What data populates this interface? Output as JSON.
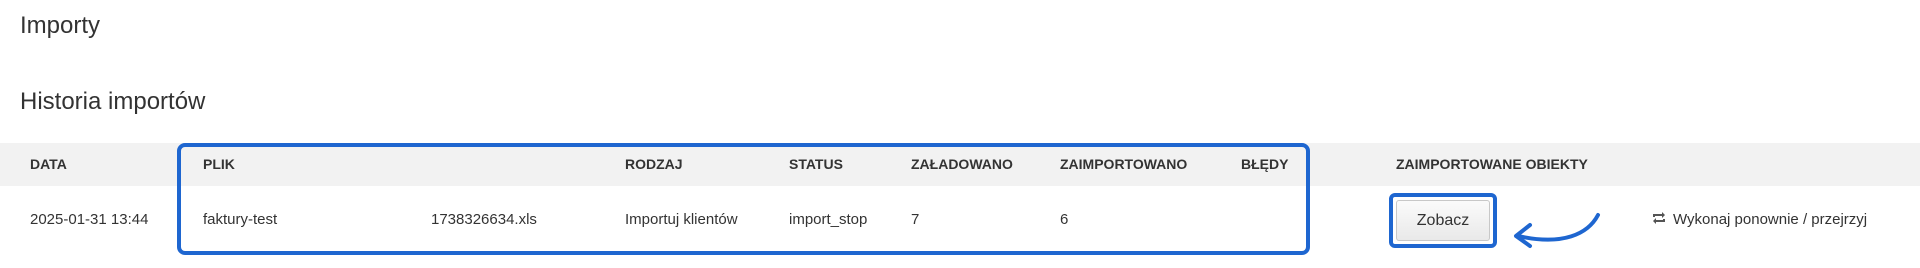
{
  "page": {
    "title": "Importy"
  },
  "history": {
    "title": "Historia importów",
    "columns": {
      "date": "DATA",
      "file": "PLIK",
      "type": "RODZAJ",
      "status": "STATUS",
      "loaded": "ZAŁADOWANO",
      "imported": "ZAIMPORTOWANO",
      "errors": "BŁĘDY",
      "objects": "ZAIMPORTOWANE OBIEKTY"
    },
    "rows": [
      {
        "date": "2025-01-31 13:44",
        "file_name": "faktury-test",
        "file_suffix": "1738326634.xls",
        "type": "Importuj klientów",
        "status": "import_stop",
        "loaded": "7",
        "imported": "6",
        "errors": "",
        "view_label": "Zobacz",
        "retry_label": "Wykonaj ponownie / przejrzyj"
      }
    ]
  },
  "colors": {
    "highlight": "#1e66d0",
    "header_bg": "#f2f2f2"
  },
  "icons": {
    "retry": "retweet-icon",
    "annotation": "curved-arrow-icon"
  }
}
